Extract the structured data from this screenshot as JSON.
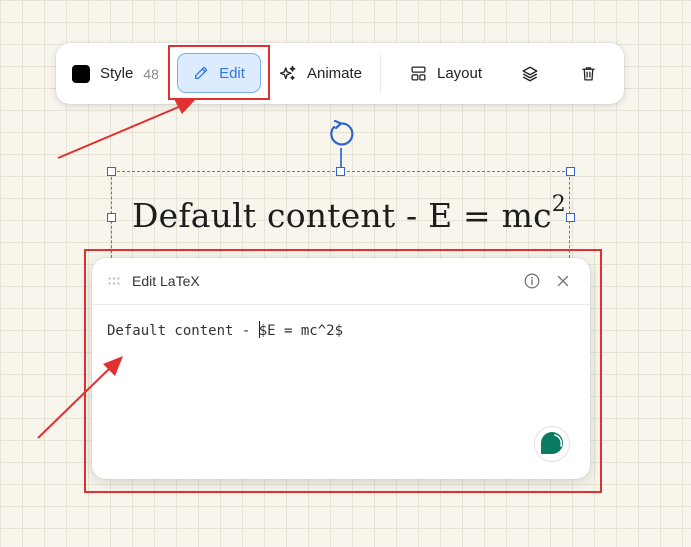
{
  "toolbar": {
    "style_label": "Style",
    "style_size": "48",
    "edit_label": "Edit",
    "animate_label": "Animate",
    "layout_label": "Layout",
    "icons": [
      "color-swatch-icon",
      "pencil-icon",
      "sparkles-icon",
      "layout-icon",
      "layers-icon",
      "trash-icon"
    ]
  },
  "canvas": {
    "latex_rendered_text": "Default content - E = mc",
    "latex_rendered_exponent": "2"
  },
  "latex_panel": {
    "title": "Edit LaTeX",
    "source_before_caret": "Default content - ",
    "source_after_caret": "$E = mc^2$"
  },
  "colors": {
    "accent": "#2f7be0",
    "highlight": "#e03030",
    "selection": "#2f66c8",
    "assistant": "#0b7a63"
  }
}
